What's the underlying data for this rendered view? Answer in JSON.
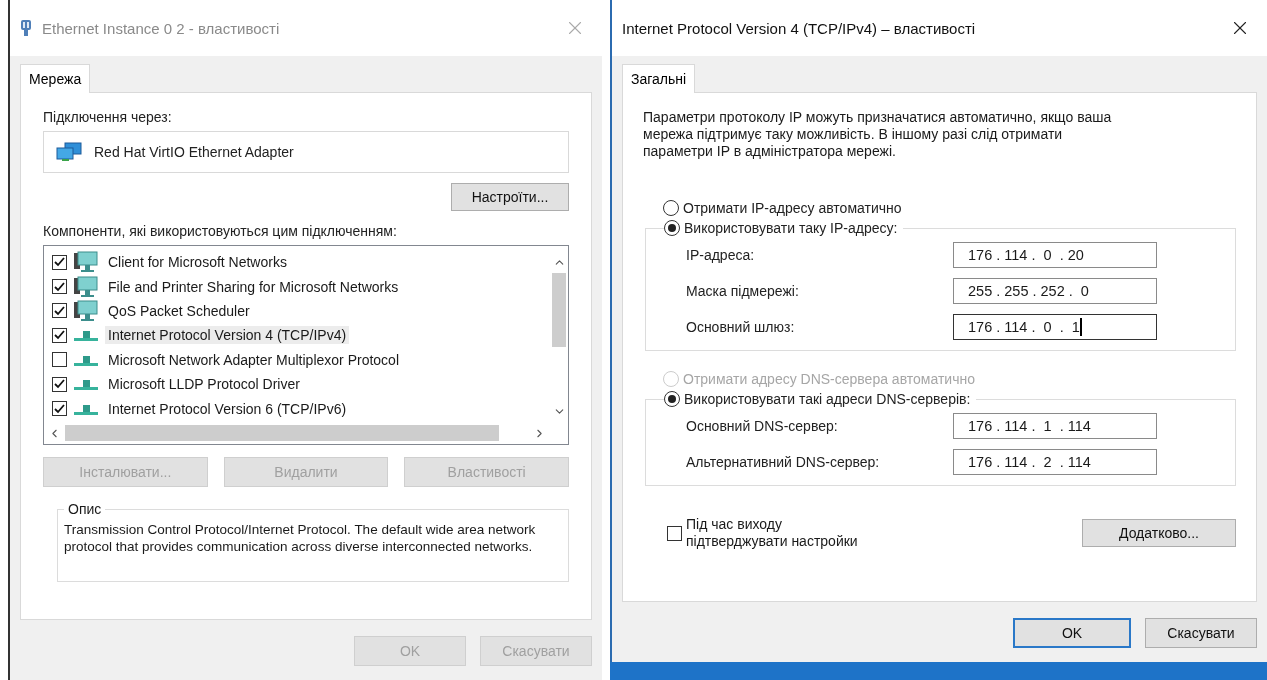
{
  "left_window": {
    "title": "Ethernet Instance 0 2 - властивості",
    "active": false,
    "tabs": [
      {
        "label": "Мережа",
        "selected": true
      }
    ],
    "connect_label": "Підключення через:",
    "adapter": "Red Hat VirtIO Ethernet Adapter",
    "configure_button": "Настроїти...",
    "components_label": "Компоненти, які використовуються цим підключенням:",
    "components": [
      {
        "label": "Client for Microsoft Networks",
        "checked": true,
        "selected": false,
        "kind": "service"
      },
      {
        "label": "File and Printer Sharing for Microsoft Networks",
        "checked": true,
        "selected": false,
        "kind": "service"
      },
      {
        "label": "QoS Packet Scheduler",
        "checked": true,
        "selected": false,
        "kind": "service"
      },
      {
        "label": "Internet Protocol Version 4 (TCP/IPv4)",
        "checked": true,
        "selected": true,
        "kind": "protocol"
      },
      {
        "label": "Microsoft Network Adapter Multiplexor Protocol",
        "checked": false,
        "selected": false,
        "kind": "protocol"
      },
      {
        "label": "Microsoft LLDP Protocol Driver",
        "checked": true,
        "selected": false,
        "kind": "protocol"
      },
      {
        "label": "Internet Protocol Version 6 (TCP/IPv6)",
        "checked": true,
        "selected": false,
        "kind": "protocol"
      }
    ],
    "component_buttons": [
      {
        "label": "Інсталювати...",
        "disabled": true
      },
      {
        "label": "Видалити",
        "disabled": true
      },
      {
        "label": "Властивості",
        "disabled": true
      }
    ],
    "description": {
      "legend": "Опис",
      "text": "Transmission Control Protocol/Internet Protocol. The default wide area network protocol that provides communication across diverse interconnected networks."
    },
    "footer_buttons": [
      {
        "label": "OK",
        "disabled": true,
        "default": false
      },
      {
        "label": "Скасувати",
        "disabled": true,
        "default": false
      }
    ]
  },
  "right_window": {
    "title": "Internet Protocol Version 4 (TCP/IPv4) – властивості",
    "active": true,
    "tabs": [
      {
        "label": "Загальні",
        "selected": true
      }
    ],
    "intro": "Параметри протоколу IP можуть призначатися автоматично, якщо ваша мережа підтримує таку можливість. В іншому разі слід отримати параметри IP в адміністратора мережі.",
    "ip_options": [
      {
        "label": "Отримати IP-адресу автоматично",
        "selected": false,
        "disabled": false
      },
      {
        "label": "Використовувати таку IP-адресу:",
        "selected": true,
        "disabled": false
      }
    ],
    "ip_fields": [
      {
        "label": "IP-адреса:",
        "value": "176 . 114 .  0  . 20",
        "focused": false
      },
      {
        "label": "Маска підмережі:",
        "value": "255 . 255 . 252 .  0",
        "focused": false
      },
      {
        "label": "Основний шлюз:",
        "value": "176 . 114 .  0  .  1",
        "focused": true
      }
    ],
    "dns_options": [
      {
        "label": "Отримати адресу DNS-сервера автоматично",
        "selected": false,
        "disabled": true
      },
      {
        "label": "Використовувати такі адреси DNS-серверів:",
        "selected": true,
        "disabled": false
      }
    ],
    "dns_fields": [
      {
        "label": "Основний DNS-сервер:",
        "value": "176 . 114 .  1  . 114",
        "focused": false
      },
      {
        "label": "Альтернативний DNS-сервер:",
        "value": "176 . 114 .  2  . 114",
        "focused": false
      }
    ],
    "validate": {
      "label": "Під час виходу підтверджувати настройки",
      "checked": false
    },
    "advanced_button": "Додатково...",
    "footer_buttons": [
      {
        "label": "OK",
        "disabled": false,
        "default": true
      },
      {
        "label": "Скасувати",
        "disabled": false,
        "default": false
      }
    ]
  }
}
